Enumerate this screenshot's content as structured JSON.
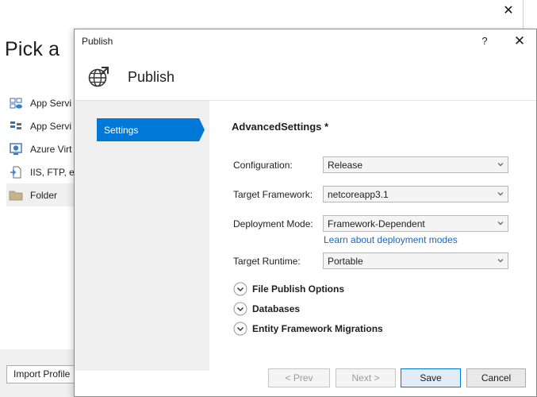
{
  "background_window": {
    "title": "Pick a",
    "close_glyph": "✕",
    "items": [
      {
        "label": "App Servi",
        "icon": "cloud-app-service-icon"
      },
      {
        "label": "App Servi",
        "icon": "app-service-linux-icon"
      },
      {
        "label": "Azure Virt",
        "icon": "azure-vm-icon"
      },
      {
        "label": "IIS, FTP, et",
        "icon": "iis-ftp-icon"
      },
      {
        "label": "Folder",
        "icon": "folder-icon"
      }
    ],
    "import_button": "Import Profile"
  },
  "dialog": {
    "window_title": "Publish",
    "help_glyph": "?",
    "close_glyph": "✕",
    "header_title": "Publish",
    "header_icon": "globe-publish-icon",
    "nav": [
      {
        "label": "Settings",
        "selected": true
      }
    ],
    "section_title": "AdvancedSettings *",
    "fields": {
      "configuration": {
        "label": "Configuration:",
        "value": "Release"
      },
      "target_framework": {
        "label": "Target Framework:",
        "value": "netcoreapp3.1"
      },
      "deployment_mode": {
        "label": "Deployment Mode:",
        "value": "Framework-Dependent"
      },
      "target_runtime": {
        "label": "Target Runtime:",
        "value": "Portable"
      }
    },
    "learn_link": "Learn about deployment modes",
    "expanders": [
      "File Publish Options",
      "Databases",
      "Entity Framework Migrations"
    ],
    "buttons": {
      "prev": "< Prev",
      "next": "Next >",
      "save": "Save",
      "cancel": "Cancel"
    }
  },
  "colors": {
    "nav_selected": "#0078d7",
    "link": "#1a65c0",
    "dialog_bg": "#f0f0f0"
  }
}
